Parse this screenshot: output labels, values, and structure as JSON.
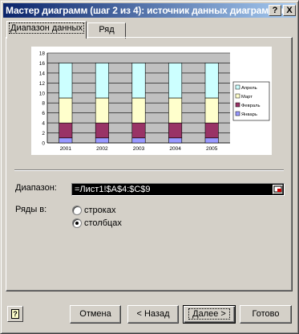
{
  "window": {
    "title": "Мастер диаграмм (шаг 2 из 4): источник данных диаграммы",
    "help_btn": "?",
    "close_btn": "X"
  },
  "tabs": [
    {
      "label": "Диапазон данных",
      "active": true
    },
    {
      "label": "Ряд",
      "active": false
    }
  ],
  "chart_data": {
    "type": "bar",
    "stacked": true,
    "categories": [
      "2001",
      "2002",
      "2003",
      "2004",
      "2005"
    ],
    "y_ticks": [
      "0",
      "2",
      "4",
      "6",
      "8",
      "10",
      "12",
      "14",
      "16",
      "18"
    ],
    "ylim": [
      0,
      18
    ],
    "grid": true,
    "legend_position": "right",
    "series": [
      {
        "name": "Январь",
        "color": "#9999ff",
        "values": [
          1,
          1,
          1,
          1,
          1
        ]
      },
      {
        "name": "Февраль",
        "color": "#993366",
        "values": [
          3,
          3,
          3,
          3,
          3
        ]
      },
      {
        "name": "Март",
        "color": "#ffffcc",
        "values": [
          5,
          5,
          5,
          5,
          5
        ]
      },
      {
        "name": "Апрель",
        "color": "#ccffff",
        "values": [
          7,
          7,
          7,
          7,
          7
        ]
      }
    ],
    "legend": [
      "Апрель",
      "Март",
      "Февраль",
      "Январь"
    ]
  },
  "form": {
    "range_label": "Диапазон:",
    "range_value": "=Лист1!$A$4:$C$9",
    "series_in_label": "Ряды в:",
    "radio_rows": "строках",
    "radio_cols": "столбцах",
    "selected": "столбцах"
  },
  "buttons": {
    "cancel": "Отмена",
    "back": "< Назад",
    "next": "Далее >",
    "finish": "Готово"
  }
}
